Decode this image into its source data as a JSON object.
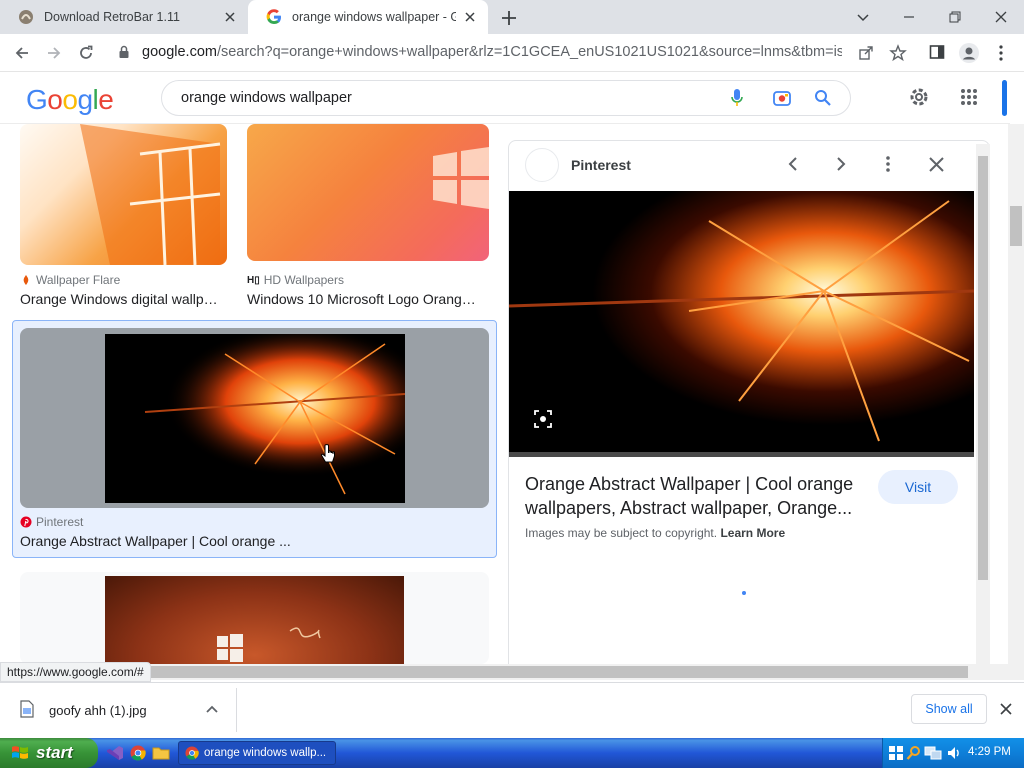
{
  "browser": {
    "tabs": [
      {
        "title": "Download RetroBar 1.11"
      },
      {
        "title": "orange windows wallpaper - Goo"
      }
    ],
    "url_host": "google.com",
    "url_path": "/search?q=orange+windows+wallpaper&rlz=1C1GCEA_enUS1021US1021&source=lnms&tbm=isch...",
    "status_url": "https://www.google.com/#"
  },
  "google": {
    "logo": [
      "G",
      "o",
      "o",
      "g",
      "l",
      "e"
    ],
    "logo_colors": [
      "#4285f4",
      "#ea4335",
      "#fbbc05",
      "#4285f4",
      "#34a853",
      "#ea4335"
    ],
    "query": "orange windows wallpaper"
  },
  "results": [
    {
      "source": "Wallpaper Flare",
      "title": "Orange Windows digital wallp…"
    },
    {
      "source": "HD Wallpapers",
      "title": "Windows 10 Microsoft Logo Orang…"
    },
    {
      "source": "Pinterest",
      "title": "Orange Abstract Wallpaper | Cool orange ..."
    }
  ],
  "preview": {
    "source": "Pinterest",
    "title": "Orange Abstract Wallpaper | Cool orange wallpapers, Abstract wallpaper, Orange...",
    "visit_label": "Visit",
    "copyright": "Images may be subject to copyright.",
    "learn_more": "Learn More"
  },
  "downloads": {
    "file_name": "goofy ahh (1).jpg",
    "show_all": "Show all"
  },
  "taskbar": {
    "start_label": "start",
    "active_window": "orange windows wallp...",
    "clock": "4:29 PM"
  },
  "colors": {
    "accent_blue": "#1a73e8",
    "selected_border": "#8ab4f8",
    "taskbar_blue": "#2157d7",
    "start_green": "#379337"
  }
}
